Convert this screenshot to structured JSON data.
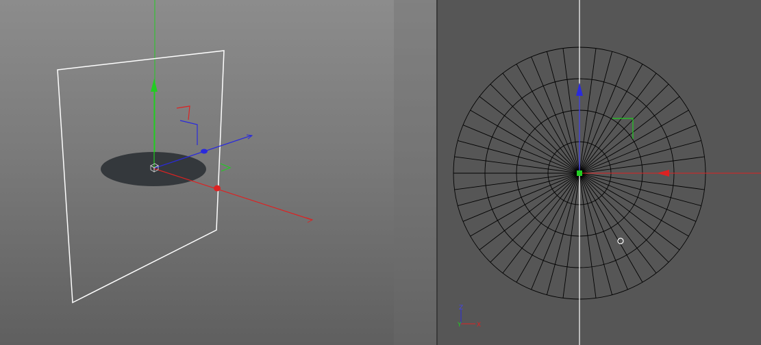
{
  "viewports": {
    "perspective": {
      "name": "perspective-viewport"
    },
    "top": {
      "name": "top-viewport",
      "mesh": {
        "radial_segments": 48,
        "rings": 4
      }
    }
  },
  "axis_indicator": {
    "vertical_label": "Z",
    "left_label": "Y",
    "horizontal_label": "X"
  },
  "colors": {
    "x_axis": "#dd2222",
    "y_axis": "#22cc22",
    "z_axis": "#2a2add",
    "disc_fill": "#34383c",
    "wire": "#000000",
    "frame": "#ffffff"
  }
}
